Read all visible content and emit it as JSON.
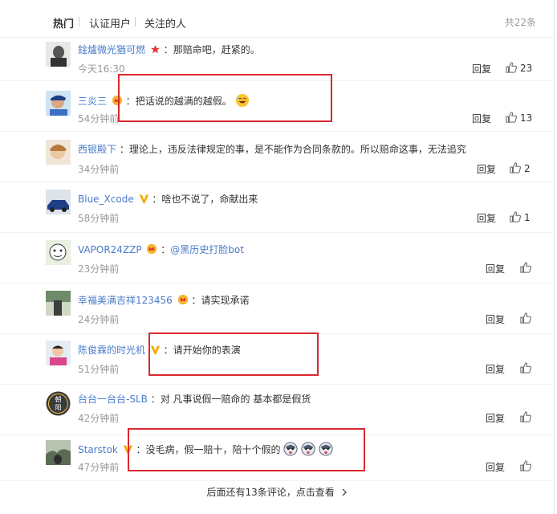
{
  "tabs": [
    {
      "label": "热门",
      "active": true
    },
    {
      "label": "认证用户",
      "active": false
    },
    {
      "label": "关注的人",
      "active": false
    }
  ],
  "total_count": "共22条",
  "reply_label": "回复",
  "comments": [
    {
      "user": "鍂爐微光猶可燃",
      "badge": "red-star",
      "text": "那赔命吧，赶紧的。",
      "time": "今天16:30",
      "likes": "23",
      "highlighted": false
    },
    {
      "user": "三炎三",
      "badge": "crown",
      "text": "把话说的越满的越假。",
      "emoji": "laughing-emoji",
      "time": "54分钟前",
      "likes": "13",
      "highlighted": true
    },
    {
      "user": "西银殿下",
      "badge": "none",
      "text": "理论上，违反法律规定的事，是不能作为合同条款的。所以赔命这事，无法追究",
      "time": "34分钟前",
      "likes": "2",
      "highlighted": false
    },
    {
      "user": "Blue_Xcode",
      "badge": "yellow-v",
      "text": "啥也不说了，命献出来",
      "time": "58分钟前",
      "likes": "1",
      "highlighted": false
    },
    {
      "user": "VAPOR24ZZP",
      "badge": "crown",
      "text": "@黑历史打脸bot",
      "time": "23分钟前",
      "likes": "",
      "highlighted": false
    },
    {
      "user": "幸福美满吉祥123456",
      "badge": "crown",
      "text": "请实现承诺",
      "time": "24分钟前",
      "likes": "",
      "highlighted": false
    },
    {
      "user": "陈俊霖的时光机",
      "badge": "yellow-v",
      "text": "请开始你的表演",
      "time": "51分钟前",
      "likes": "",
      "highlighted": true
    },
    {
      "user": "台台一台台-SLB",
      "badge": "none",
      "text": "对 凡事说假一赔命的 基本都是假货",
      "time": "42分钟前",
      "likes": "",
      "highlighted": false
    },
    {
      "user": "Starstok",
      "badge": "yellow-v",
      "text": "没毛病，假一赔十，陪十个假的",
      "emoji": "husky-emoji x3",
      "time": "47分钟前",
      "likes": "",
      "highlighted": true
    }
  ],
  "footer": {
    "more_text": "后面还有13条评论，点击查看",
    "arrow": "chevron-right-icon"
  },
  "colors": {
    "username": "#4a7cc9",
    "highlight_box": "#d9282f",
    "time": "#999999"
  }
}
